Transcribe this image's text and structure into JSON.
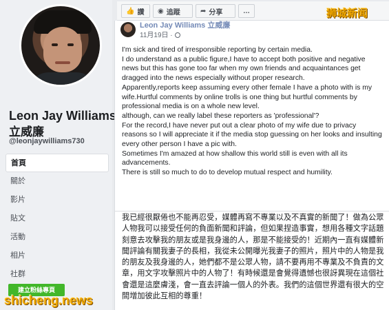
{
  "profile": {
    "name": "Leon Jay Williams",
    "chinese_name": "立威廉",
    "handle": "@leonjaywilliams730"
  },
  "nav": {
    "items": [
      {
        "label": "首頁",
        "active": true
      },
      {
        "label": "關於",
        "active": false
      },
      {
        "label": "影片",
        "active": false
      },
      {
        "label": "貼文",
        "active": false
      },
      {
        "label": "活動",
        "active": false
      },
      {
        "label": "相片",
        "active": false
      },
      {
        "label": "社群",
        "active": false
      }
    ],
    "create_page_label": "建立粉絲專頁"
  },
  "toolbar": {
    "like_label": "讚",
    "follow_label": "追蹤",
    "share_label": "分享",
    "more_label": "…"
  },
  "post": {
    "author": "Leon Jay Williams 立威廉",
    "date": "11月19日 ·",
    "english_lines": [
      "I'm sick and tired of irresponsible reporting by certain media.",
      "I do understand as a public figure,I have to accept both positive and negative news but this has gone too far when my own friends and acquaintances get dragged into the news especially without proper research.",
      "Apparently,reports keep assuming every other female I have a photo with is my wife.Hurtful comments by online trolls is one thing but hurtful comments by professional media is on a whole new level.",
      "although, can we really label these reporters as 'professional'?",
      "For the record,I have never put out a clear photo of my wife due to privacy reasons so I will appreciate it if the media stop guessing on her looks and insulting every other person I have a pic with.",
      "Sometimes I'm amazed at how shallow this world still is even with all its advancements.",
      "There is still so much to do to develop mutual respect and humility."
    ],
    "chinese_text": "我已經很厭倦也不能再忍受，媒體再寫不專業以及不真實的新聞了！做為公眾人物我可以接受任何的負面新聞和評論，但如果捏造事實，想用各種文字話題刻意去攻擊我的朋友或是我身邊的人，那是不能接受的！近期內一直有媒體新聞評論有關我妻子的長相，我從未公開曝光我妻子的照片，照片中的人物是我的朋友及我身邊的人，她們都不是公眾人物，請不要再用不專業及不負責的文章，用文字攻擊照片中的人物了！有時候還是會覺得遺憾也很訝異現在這個社會還是這麼膚淺，會一直去評論一個人的外表。我們的這個世界還有很大的空間增加彼此互相的尊重！"
  },
  "watermarks": {
    "top_right": "狮城新闻",
    "bottom_left": "shicheng.news"
  },
  "colors": {
    "accent": "#385898",
    "create_button": "#42b72a",
    "watermark": "#f0a800"
  }
}
